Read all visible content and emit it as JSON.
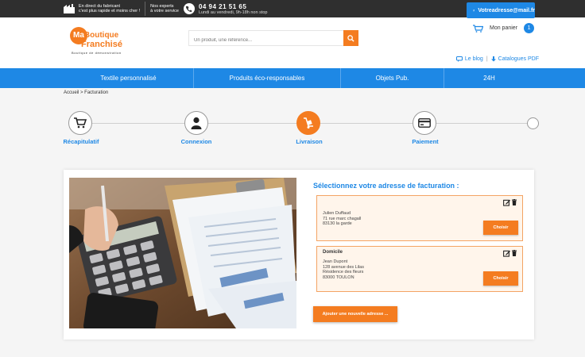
{
  "topbar": {
    "factory_line1": "En direct du fabricant",
    "factory_line2": "c'est plus rapide et moins cher !",
    "experts_line1": "Nos experts",
    "experts_line2": "à votre service",
    "phone": "04 94 21 51 65",
    "hours": "Lundi au vendredi, 9h-18h non stop"
  },
  "account": {
    "email": "Votreadresse@mail.fr"
  },
  "cart": {
    "label": "Mon panier",
    "count": "1"
  },
  "logo": {
    "ma": "Ma",
    "boutique": "Boutique",
    "franchise": "Franchisé",
    "tagline": "Boutique de démonstration"
  },
  "search": {
    "placeholder": "Un produit, une référence..."
  },
  "header_links": {
    "blog": "Le blog",
    "catalogues": "Catalogues PDF",
    "separator": "|"
  },
  "nav": {
    "items": [
      {
        "label": "Textile personnalisé"
      },
      {
        "label": "Produits éco-responsables"
      },
      {
        "label": "Objets Pub."
      },
      {
        "label": "24H"
      }
    ]
  },
  "breadcrumb": "Accueil > Facturation",
  "steps": [
    {
      "label": "Récapitulatif",
      "icon": "cart-icon"
    },
    {
      "label": "Connexion",
      "icon": "user-icon"
    },
    {
      "label": "Livraison",
      "icon": "delivery-icon"
    },
    {
      "label": "Paiement",
      "icon": "card-icon"
    }
  ],
  "colors": {
    "accent_blue": "#1e88e5",
    "accent_orange": "#f47c20"
  },
  "billing": {
    "title": "Sélectionnez votre adresse de facturation :",
    "addresses": [
      {
        "name": "",
        "lines": [
          "Julien Duffaud",
          "71 rue marc chagall",
          "83130 la garde"
        ],
        "choose_label": "Choisir"
      },
      {
        "name": "Domicile",
        "lines": [
          "Jean Dupont",
          "128 avenue des Lilas",
          "Résidence des fleurs",
          "83000 TOULON"
        ],
        "choose_label": "Choisir"
      }
    ],
    "add_label": "Ajouter une nouvelle adresse ..."
  }
}
